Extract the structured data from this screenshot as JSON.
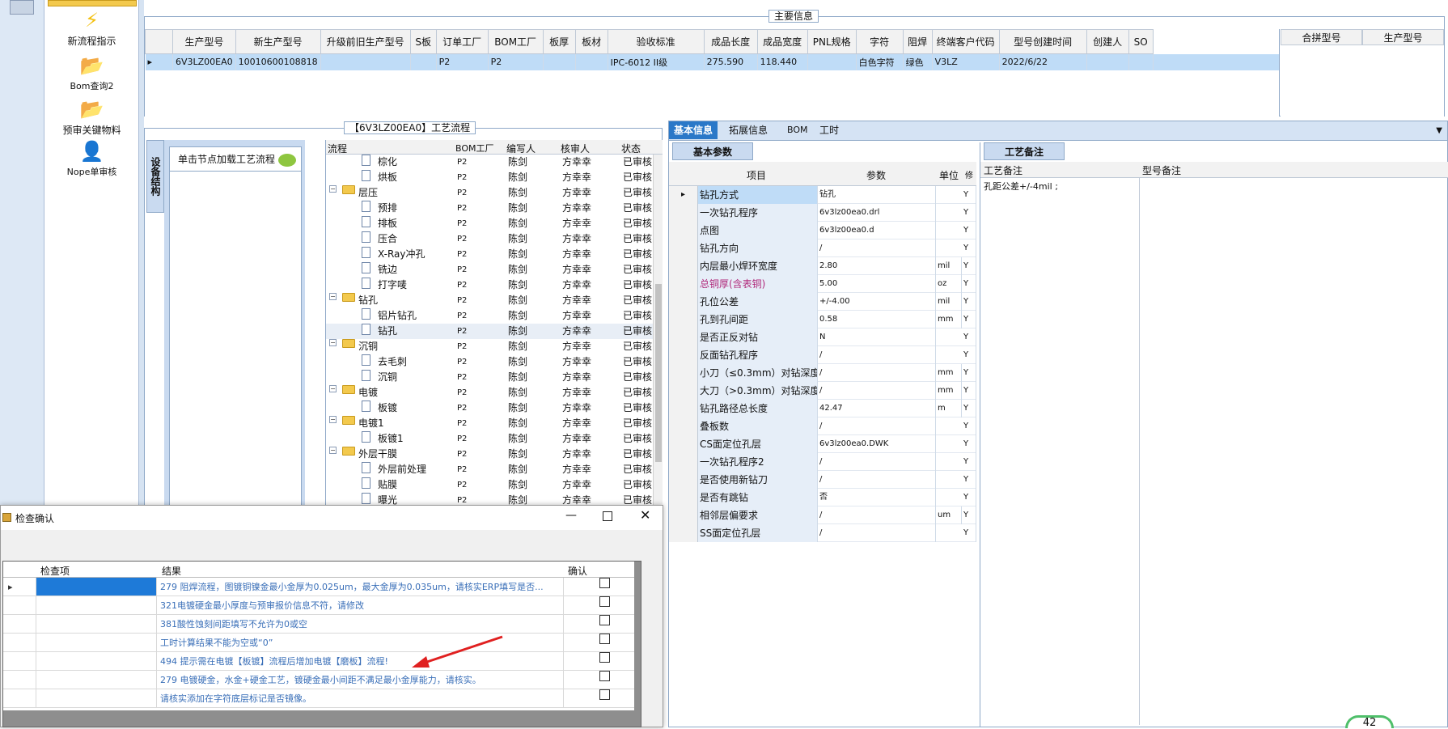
{
  "sidebar": {
    "items": [
      {
        "label": "新流程指示",
        "icon": "lightning-icon"
      },
      {
        "label": "Bom查询2",
        "icon": "folder-open-icon"
      },
      {
        "label": "预审关键物料",
        "icon": "folder-open-icon"
      },
      {
        "label": "Nope单审核",
        "icon": "user-icon"
      }
    ]
  },
  "main_info": {
    "legend": "主要信息",
    "columns": [
      "生产型号",
      "新生产型号",
      "升级前旧生产型号",
      "S板",
      "订单工厂",
      "BOM工厂",
      "板厚",
      "板材",
      "验收标准",
      "成品长度",
      "成品宽度",
      "PNL规格",
      "字符",
      "阻焊",
      "终端客户代码",
      "型号创建时间",
      "创建人",
      "SO"
    ],
    "row": [
      "6V3LZ00EA0",
      "10010600108818",
      "",
      "",
      "P2",
      "P2",
      "",
      "",
      "IPC-6012 II级",
      "275.590",
      "118.440",
      "",
      "白色字符",
      "绿色",
      "V3LZ",
      "2022/6/22",
      "",
      ""
    ],
    "merge_columns": [
      "合拼型号",
      "生产型号"
    ]
  },
  "process": {
    "legend": "【6V3LZ00EA0】工艺流程",
    "vertical_tab": "设备结构",
    "hint": "单击节点加载工艺流程",
    "columns": [
      "流程",
      "BOM工厂",
      "编写人",
      "核审人",
      "状态"
    ],
    "rows": [
      {
        "name": "棕化",
        "level": 2,
        "type": "doc",
        "bom": "P2",
        "writer": "陈剑",
        "checker": "方幸幸",
        "status": "已审核"
      },
      {
        "name": "烘板",
        "level": 2,
        "type": "doc",
        "bom": "P2",
        "writer": "陈剑",
        "checker": "方幸幸",
        "status": "已审核"
      },
      {
        "name": "层压",
        "level": 1,
        "type": "folder",
        "bom": "P2",
        "writer": "陈剑",
        "checker": "方幸幸",
        "status": "已审核"
      },
      {
        "name": "预排",
        "level": 2,
        "type": "doc",
        "bom": "P2",
        "writer": "陈剑",
        "checker": "方幸幸",
        "status": "已审核"
      },
      {
        "name": "排板",
        "level": 2,
        "type": "doc",
        "bom": "P2",
        "writer": "陈剑",
        "checker": "方幸幸",
        "status": "已审核"
      },
      {
        "name": "压合",
        "level": 2,
        "type": "doc",
        "bom": "P2",
        "writer": "陈剑",
        "checker": "方幸幸",
        "status": "已审核"
      },
      {
        "name": "X-Ray冲孔",
        "level": 2,
        "type": "doc",
        "bom": "P2",
        "writer": "陈剑",
        "checker": "方幸幸",
        "status": "已审核"
      },
      {
        "name": "铣边",
        "level": 2,
        "type": "doc",
        "bom": "P2",
        "writer": "陈剑",
        "checker": "方幸幸",
        "status": "已审核"
      },
      {
        "name": "打字唛",
        "level": 2,
        "type": "doc",
        "bom": "P2",
        "writer": "陈剑",
        "checker": "方幸幸",
        "status": "已审核"
      },
      {
        "name": "钻孔",
        "level": 1,
        "type": "folder",
        "bom": "P2",
        "writer": "陈剑",
        "checker": "方幸幸",
        "status": "已审核"
      },
      {
        "name": "铝片钻孔",
        "level": 2,
        "type": "doc",
        "bom": "P2",
        "writer": "陈剑",
        "checker": "方幸幸",
        "status": "已审核"
      },
      {
        "name": "钻孔",
        "level": 2,
        "type": "doc",
        "bom": "P2",
        "writer": "陈剑",
        "checker": "方幸幸",
        "status": "已审核"
      },
      {
        "name": "沉铜",
        "level": 1,
        "type": "folder",
        "bom": "P2",
        "writer": "陈剑",
        "checker": "方幸幸",
        "status": "已审核"
      },
      {
        "name": "去毛刺",
        "level": 2,
        "type": "doc",
        "bom": "P2",
        "writer": "陈剑",
        "checker": "方幸幸",
        "status": "已审核"
      },
      {
        "name": "沉铜",
        "level": 2,
        "type": "doc",
        "bom": "P2",
        "writer": "陈剑",
        "checker": "方幸幸",
        "status": "已审核"
      },
      {
        "name": "电镀",
        "level": 1,
        "type": "folder",
        "bom": "P2",
        "writer": "陈剑",
        "checker": "方幸幸",
        "status": "已审核"
      },
      {
        "name": "板镀",
        "level": 2,
        "type": "doc",
        "bom": "P2",
        "writer": "陈剑",
        "checker": "方幸幸",
        "status": "已审核"
      },
      {
        "name": "电镀1",
        "level": 1,
        "type": "folder",
        "bom": "P2",
        "writer": "陈剑",
        "checker": "方幸幸",
        "status": "已审核"
      },
      {
        "name": "板镀1",
        "level": 2,
        "type": "doc",
        "bom": "P2",
        "writer": "陈剑",
        "checker": "方幸幸",
        "status": "已审核"
      },
      {
        "name": "外层干膜",
        "level": 1,
        "type": "folder",
        "bom": "P2",
        "writer": "陈剑",
        "checker": "方幸幸",
        "status": "已审核"
      },
      {
        "name": "外层前处理",
        "level": 2,
        "type": "doc",
        "bom": "P2",
        "writer": "陈剑",
        "checker": "方幸幸",
        "status": "已审核"
      },
      {
        "name": "贴膜",
        "level": 2,
        "type": "doc",
        "bom": "P2",
        "writer": "陈剑",
        "checker": "方幸幸",
        "status": "已审核"
      },
      {
        "name": "曝光",
        "level": 2,
        "type": "doc",
        "bom": "P2",
        "writer": "陈剑",
        "checker": "方幸幸",
        "status": "已审核"
      }
    ]
  },
  "detail_tabs": [
    "基本信息",
    "拓展信息",
    "BOM",
    "工时"
  ],
  "basic_params": {
    "tab": "基本参数",
    "columns": [
      "项目",
      "参数",
      "单位",
      "修"
    ],
    "rows": [
      {
        "item": "钻孔方式",
        "value": "钻孔",
        "unit": "",
        "flag": "Y"
      },
      {
        "item": "一次钻孔程序",
        "value": "6v3lz00ea0.drl",
        "unit": "",
        "flag": "Y"
      },
      {
        "item": "点图",
        "value": "6v3lz00ea0.d",
        "unit": "",
        "flag": "Y"
      },
      {
        "item": "钻孔方向",
        "value": "/",
        "unit": "",
        "flag": "Y"
      },
      {
        "item": "内层最小焊环宽度",
        "value": "2.80",
        "unit": "mil",
        "flag": "Y"
      },
      {
        "item": "总铜厚(含表铜)",
        "value": "5.00",
        "unit": "oz",
        "flag": "Y"
      },
      {
        "item": "孔位公差",
        "value": "+/-4.00",
        "unit": "mil",
        "flag": "Y"
      },
      {
        "item": "孔到孔间距",
        "value": "0.58",
        "unit": "mm",
        "flag": "Y"
      },
      {
        "item": "是否正反对钻",
        "value": "N",
        "unit": "",
        "flag": "Y"
      },
      {
        "item": "反面钻孔程序",
        "value": "/",
        "unit": "",
        "flag": "Y"
      },
      {
        "item": "小刀（≤0.3mm）对钻深度",
        "value": "/",
        "unit": "mm",
        "flag": "Y"
      },
      {
        "item": "大刀（>0.3mm）对钻深度",
        "value": "/",
        "unit": "mm",
        "flag": "Y"
      },
      {
        "item": "钻孔路径总长度",
        "value": "42.47",
        "unit": "m",
        "flag": "Y"
      },
      {
        "item": "叠板数",
        "value": "/",
        "unit": "",
        "flag": "Y"
      },
      {
        "item": "CS面定位孔层",
        "value": "6v3lz00ea0.DWK",
        "unit": "",
        "flag": "Y"
      },
      {
        "item": "一次钻孔程序2",
        "value": "/",
        "unit": "",
        "flag": "Y"
      },
      {
        "item": "是否使用新钻刀",
        "value": "/",
        "unit": "",
        "flag": "Y"
      },
      {
        "item": "是否有跳钻",
        "value": "否",
        "unit": "",
        "flag": "Y"
      },
      {
        "item": "相邻层偏要求",
        "value": "/",
        "unit": "um",
        "flag": "Y"
      },
      {
        "item": "SS面定位孔层",
        "value": "/",
        "unit": "",
        "flag": "Y"
      }
    ]
  },
  "remarks": {
    "tab": "工艺备注",
    "columns": [
      "工艺备注",
      "型号备注"
    ],
    "value": "孔距公差+/-4mil ;"
  },
  "dialog": {
    "title": "检查确认",
    "columns": [
      "检查项",
      "结果",
      "确认"
    ],
    "rows": [
      "279 阻焊流程，图镀铜镍金最小金厚为0.025um，最大金厚为0.035um，请核实ERP填写是否...",
      "321电镀硬金最小厚度与预审报价信息不符，请修改",
      "381酸性蚀刻间距填写不允许为0或空",
      "工时计算结果不能为空或“0”",
      "494 提示需在电镀【板镀】流程后增加电镀【磨板】流程!",
      "279 电镀硬金，水金+硬金工艺，镀硬金最小间距不满足最小金厚能力，请核实。",
      "请核实添加在字符底层标记是否镜像。"
    ]
  },
  "badge": "42",
  "colors": {
    "accent": "#2a78c8",
    "selected_row": "#bfdcf7",
    "highlight_text": "#b0287a",
    "dialog_text": "#3a6fb8",
    "arrow": "#e02020"
  }
}
